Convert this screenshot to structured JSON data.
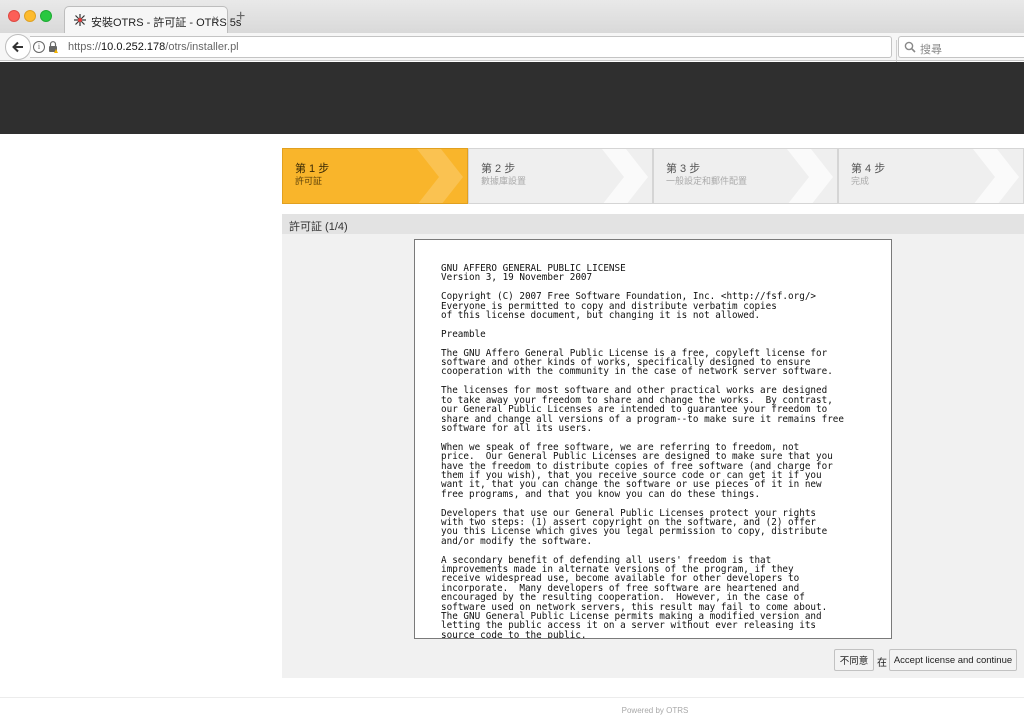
{
  "browser": {
    "tab_title": "安裝OTRS - 許可証 - OTRS 5s",
    "tab_close": "×",
    "new_tab": "+",
    "url_scheme": "https://",
    "url_host": "10.0.252.178",
    "url_path": "/otrs/installer.pl",
    "search_placeholder": "搜尋"
  },
  "steps": [
    {
      "label": "第 1 步",
      "sub": "許可証",
      "active": true
    },
    {
      "label": "第 2 步",
      "sub": "數據庫設置",
      "active": false
    },
    {
      "label": "第 3 步",
      "sub": "一般設定和郵件配置",
      "active": false
    },
    {
      "label": "第 4 步",
      "sub": "完成",
      "active": false
    }
  ],
  "panel": {
    "title": "許可証 (1/4)",
    "license_text": "GNU AFFERO GENERAL PUBLIC LICENSE\nVersion 3, 19 November 2007\n\nCopyright (C) 2007 Free Software Foundation, Inc. <http://fsf.org/>\nEveryone is permitted to copy and distribute verbatim copies\nof this license document, but changing it is not allowed.\n\nPreamble\n\nThe GNU Affero General Public License is a free, copyleft license for\nsoftware and other kinds of works, specifically designed to ensure\ncooperation with the community in the case of network server software.\n\nThe licenses for most software and other practical works are designed\nto take away your freedom to share and change the works.  By contrast,\nour General Public Licenses are intended to guarantee your freedom to\nshare and change all versions of a program--to make sure it remains free\nsoftware for all its users.\n\nWhen we speak of free software, we are referring to freedom, not\nprice.  Our General Public Licenses are designed to make sure that you\nhave the freedom to distribute copies of free software (and charge for\nthem if you wish), that you receive source code or can get it if you\nwant it, that you can change the software or use pieces of it in new\nfree programs, and that you know you can do these things.\n\nDevelopers that use our General Public Licenses protect your rights\nwith two steps: (1) assert copyright on the software, and (2) offer\nyou this License which gives you legal permission to copy, distribute\nand/or modify the software.\n\nA secondary benefit of defending all users' freedom is that\nimprovements made in alternate versions of the program, if they\nreceive widespread use, become available for other developers to\nincorporate.  Many developers of free software are heartened and\nencouraged by the resulting cooperation.  However, in the case of\nsoftware used on network servers, this result may fail to come about.\nThe GNU General Public License permits making a modified version and\nletting the public access it on a server without ever releasing its\nsource code to the public."
  },
  "actions": {
    "disagree_label": "不同意",
    "or_text": "在",
    "accept_label": "Accept license and continue"
  },
  "footer": {
    "powered_by": "Powered by OTRS"
  },
  "colors": {
    "active_step": "#f9b52b",
    "header_bar": "#2f2f2f"
  },
  "icons": [
    "back-arrow-icon",
    "info-icon",
    "lock-warning-icon",
    "reload-icon",
    "search-icon",
    "otrs-favicon-icon"
  ]
}
